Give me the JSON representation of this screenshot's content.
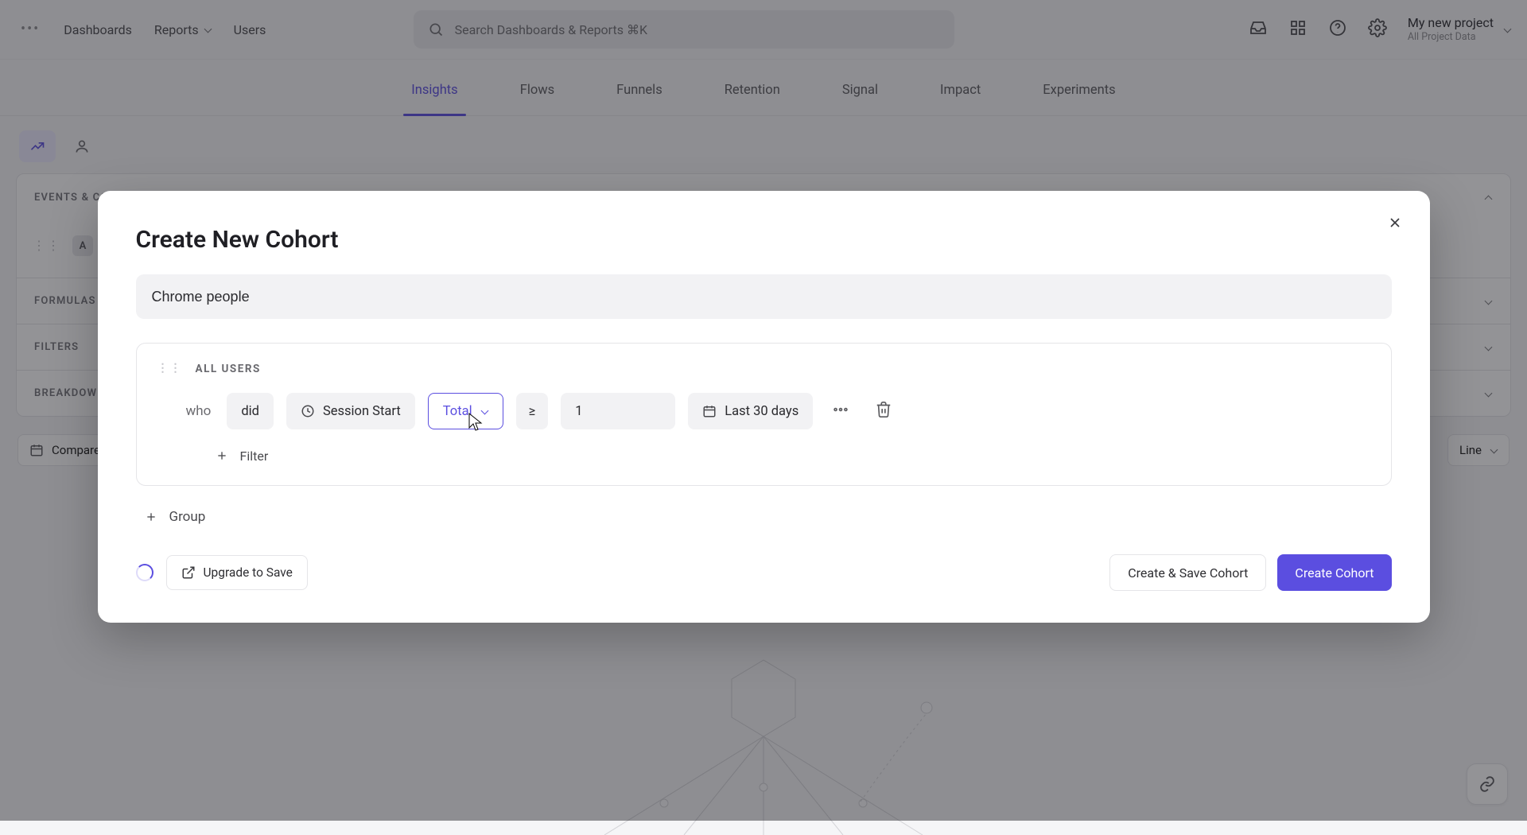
{
  "topnav": {
    "items": [
      "Dashboards",
      "Reports",
      "Users"
    ]
  },
  "search": {
    "placeholder": "Search Dashboards & Reports ⌘K"
  },
  "project": {
    "title": "My new project",
    "subtitle": "All Project Data"
  },
  "tabs": [
    "Insights",
    "Flows",
    "Funnels",
    "Retention",
    "Signal",
    "Impact",
    "Experiments"
  ],
  "active_tab": "Insights",
  "sections": {
    "events": "EVENTS & COHORTS",
    "formulas": "FORMULAS",
    "filters": "FILTERS",
    "breakdowns": "BREAKDOWNS"
  },
  "event_badge": "A",
  "compare": {
    "label": "Compare"
  },
  "chart_type": {
    "label": "Line"
  },
  "modal": {
    "title": "Create New Cohort",
    "name_value": "Chrome people",
    "all_users": "ALL USERS",
    "who": "who",
    "did": "did",
    "event": "Session Start",
    "agg": "Total",
    "op": "≥",
    "count": "1",
    "range": "Last 30 days",
    "filter": "Filter",
    "group": "Group",
    "upgrade": "Upgrade to Save",
    "create_save": "Create & Save Cohort",
    "create": "Create Cohort"
  }
}
